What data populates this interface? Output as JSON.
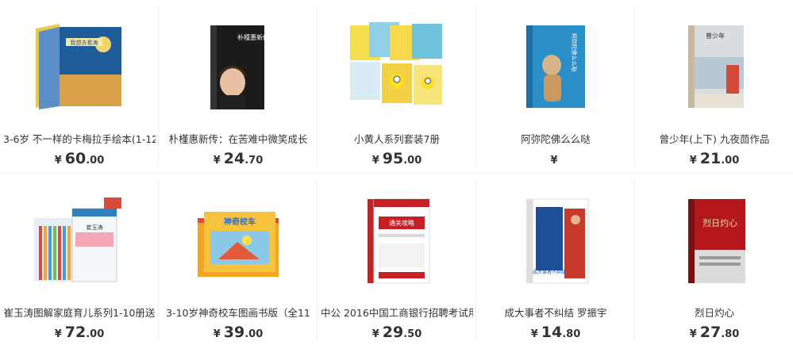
{
  "currency_symbol": "¥",
  "row1": [
    {
      "title": "3-6岁 不一样的卡梅拉手绘本(1-12",
      "price_int": "60",
      "price_dec": ".00",
      "cover_text": "我想去看海"
    },
    {
      "title": "朴槿惠新传：在苦难中微笑成长",
      "price_int": "24",
      "price_dec": ".70",
      "cover_text": "朴槿惠新传"
    },
    {
      "title": "小黄人系列套装7册",
      "price_int": "95",
      "price_dec": ".00",
      "cover_text": ""
    },
    {
      "title": "阿弥陀佛么么哒",
      "price_int": "",
      "price_dec": "",
      "cover_text": "阿弥陀佛么么哒"
    },
    {
      "title": "曾少年(上下) 九夜茴作品",
      "price_int": "21",
      "price_dec": ".00",
      "cover_text": "曾少年"
    }
  ],
  "row2": [
    {
      "title": "崔玉涛图解家庭育儿系列1-10册送",
      "price_int": "72",
      "price_dec": ".00",
      "cover_text": "崔玉涛"
    },
    {
      "title": "3-10岁神奇校车图画书版（全11",
      "price_int": "39",
      "price_dec": ".00",
      "cover_text": "神奇校车"
    },
    {
      "title": "中公 2016中国工商银行招聘考试用",
      "price_int": "29",
      "price_dec": ".50",
      "cover_text": "通关攻略"
    },
    {
      "title": "成大事者不纠结 罗振宇",
      "price_int": "14",
      "price_dec": ".80",
      "cover_text": "成大事者不纠结"
    },
    {
      "title": "烈日灼心",
      "price_int": "27",
      "price_dec": ".80",
      "cover_text": "烈日灼心"
    }
  ]
}
